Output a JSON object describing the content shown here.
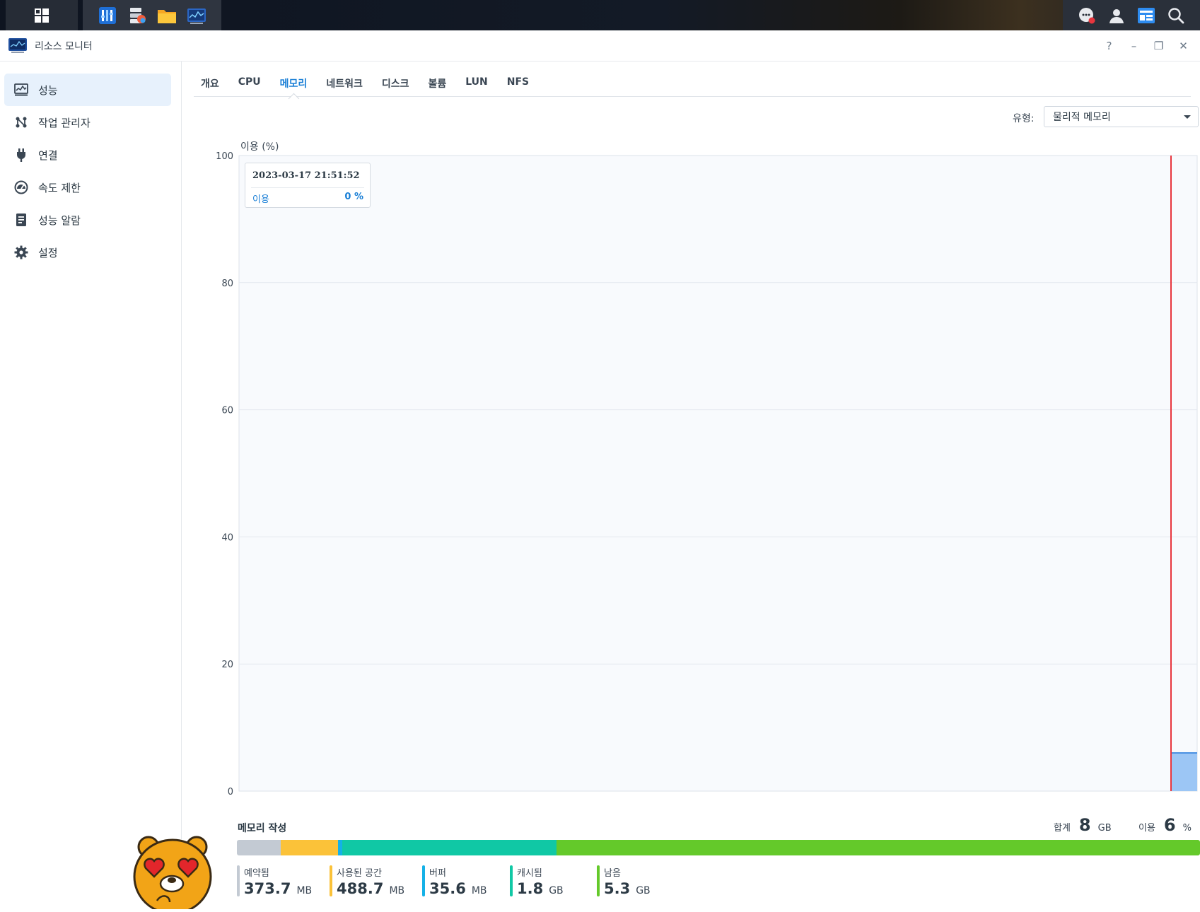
{
  "window": {
    "title": "리소스 모니터",
    "controls": {
      "help": "?",
      "minimize": "–",
      "restore": "❐",
      "close": "✕"
    }
  },
  "sidebar": {
    "items": [
      {
        "label": "성능",
        "icon": "performance-chart-icon",
        "active": true
      },
      {
        "label": "작업 관리자",
        "icon": "task-manager-icon",
        "active": false
      },
      {
        "label": "연결",
        "icon": "plug-icon",
        "active": false
      },
      {
        "label": "속도 제한",
        "icon": "speed-gauge-icon",
        "active": false
      },
      {
        "label": "성능 알람",
        "icon": "alarm-document-icon",
        "active": false
      },
      {
        "label": "설정",
        "icon": "gear-icon",
        "active": false
      }
    ]
  },
  "tabs": [
    {
      "label": "개요"
    },
    {
      "label": "CPU"
    },
    {
      "label": "메모리",
      "active": true
    },
    {
      "label": "네트워크"
    },
    {
      "label": "디스크"
    },
    {
      "label": "볼륨"
    },
    {
      "label": "LUN"
    },
    {
      "label": "NFS"
    }
  ],
  "type_filter": {
    "label": "유형:",
    "value": "물리적 메모리"
  },
  "tooltip": {
    "timestamp": "2023-03-17 21:51:52",
    "label": "이용",
    "value": "0 %"
  },
  "chart_data": {
    "type": "area",
    "title": "",
    "ylabel": "이용 (%)",
    "ylim": [
      0,
      100
    ],
    "yticks": [
      "100",
      "80",
      "60",
      "40",
      "20",
      "0"
    ],
    "grid": true,
    "series": [
      {
        "name": "이용",
        "values": [
          6,
          6,
          6
        ]
      }
    ],
    "cursor": "2023-03-17 21:51:52",
    "colors": {
      "line": "#4a90e2",
      "fill": "#9cc6f5",
      "cursor": "#e8363e",
      "plot_bg": "#f8fafd"
    }
  },
  "memory": {
    "title": "메모리 작성",
    "total": {
      "label": "합계",
      "value": "8",
      "unit": "GB"
    },
    "usage": {
      "label": "이용",
      "value": "6",
      "unit": "%"
    },
    "segments": [
      {
        "name": "예약됨",
        "value": "373.7",
        "unit": "MB",
        "color": "#c3cad3",
        "fraction": 0.0456
      },
      {
        "name": "사용된 공간",
        "value": "488.7",
        "unit": "MB",
        "color": "#fbc239",
        "fraction": 0.0597
      },
      {
        "name": "버퍼",
        "value": "35.6",
        "unit": "MB",
        "color": "#14b1e7",
        "fraction": 0.0043
      },
      {
        "name": "캐시됨",
        "value": "1.8",
        "unit": "GB",
        "color": "#10c8a5",
        "fraction": 0.2222
      },
      {
        "name": "남음",
        "value": "5.3",
        "unit": "GB",
        "color": "#64c92a",
        "fraction": 0.6682
      }
    ]
  },
  "taskbar": {
    "icons": [
      "main-menu-icon",
      "control-panel-icon",
      "package-center-icon",
      "file-station-icon",
      "resource-monitor-icon"
    ],
    "tray": [
      "notifications-icon",
      "user-icon",
      "widgets-icon",
      "search-icon"
    ]
  }
}
